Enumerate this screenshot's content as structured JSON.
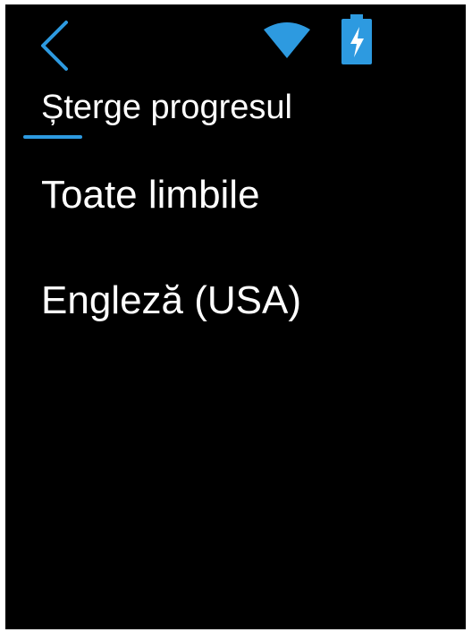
{
  "header": {
    "title": "Șterge progresul",
    "back_icon": "chevron-left-icon",
    "status_icons": [
      "wifi-icon",
      "battery-charging-icon"
    ]
  },
  "menu": {
    "items": [
      {
        "label": "Toate limbile"
      },
      {
        "label": "Engleză (USA)"
      }
    ]
  },
  "colors": {
    "background": "#000000",
    "accent": "#2d9ae0",
    "text": "#ffffff"
  }
}
